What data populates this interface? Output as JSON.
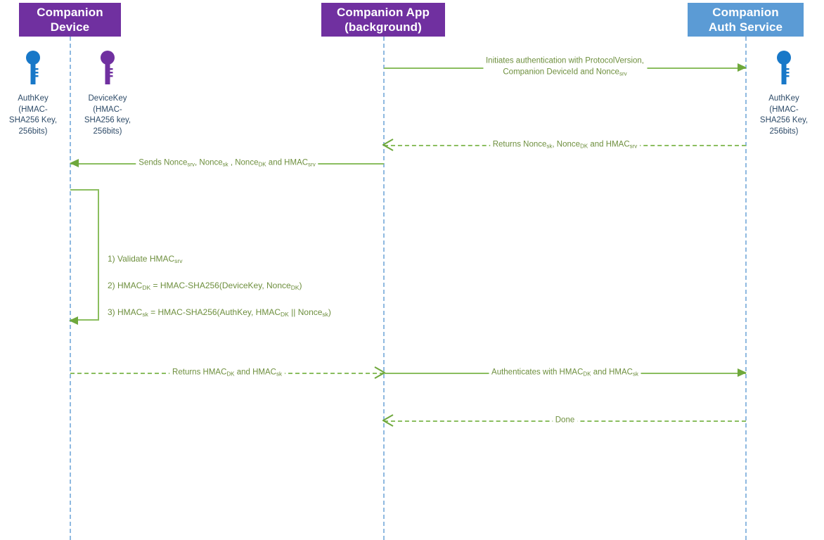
{
  "diagram": {
    "title": "Companion device authentication sequence",
    "colors": {
      "participant_purple": "#7030A0",
      "participant_blue": "#5B9BD5",
      "lifeline": "#8FB9E0",
      "message_line": "#8BBE5F",
      "message_text": "#6E8F3E",
      "caption_text": "#2E4B68",
      "key_blue": "#1878C8",
      "key_purple": "#7030A0",
      "background": "#FFFFFF"
    }
  },
  "participants": [
    {
      "id": "companion-device",
      "line1": "Companion",
      "line2": "Device",
      "style": "purple"
    },
    {
      "id": "companion-app",
      "line1": "Companion App",
      "line2": "(background)",
      "style": "purple"
    },
    {
      "id": "companion-auth-service",
      "line1": "Companion",
      "line2": "Auth Service",
      "style": "blue"
    }
  ],
  "keys": [
    {
      "id": "device-authkey",
      "name": "AuthKey",
      "caption": "AuthKey\n(HMAC-\nSHA256 Key,\n256bits)",
      "color": "#1878C8",
      "owner": "companion-device"
    },
    {
      "id": "device-devicekey",
      "name": "DeviceKey",
      "caption": "DeviceKey\n(HMAC-\nSHA256 key,\n256bits)",
      "color": "#7030A0",
      "owner": "companion-device"
    },
    {
      "id": "service-authkey",
      "name": "AuthKey",
      "caption": "AuthKey\n(HMAC-\nSHA256 Key,\n256bits)",
      "color": "#1878C8",
      "owner": "companion-auth-service"
    }
  ],
  "messages": [
    {
      "id": "msg-initiates",
      "text": "Initiates authentication with ProtocolVersion,\nCompanion DeviceId and Nonce",
      "text_sub": "srv",
      "from": "companion-app",
      "to": "companion-auth-service",
      "style": "solid",
      "arrow": "filled",
      "direction": "right"
    },
    {
      "id": "msg-returns-nonces",
      "text_html": "Returns Nonce<sub>sk</sub>, Nonce<sub>DK</sub> and HMAC<sub>srv</sub>",
      "from": "companion-auth-service",
      "to": "companion-app",
      "style": "dashed",
      "arrow": "open",
      "direction": "left"
    },
    {
      "id": "msg-sends-nonces",
      "text_html": "Sends Nonce<sub>srv</sub>, Nonce<sub>sk</sub> , Nonce<sub>DK</sub> and HMAC<sub>srv</sub>",
      "from": "companion-app",
      "to": "companion-device",
      "style": "solid",
      "arrow": "filled",
      "direction": "left"
    },
    {
      "id": "msg-returns-hmacs",
      "text_html": "Returns HMAC<sub>DK</sub> and HMAC<sub>sk</sub>",
      "from": "companion-device",
      "to": "companion-app",
      "style": "dashed",
      "arrow": "open",
      "direction": "right"
    },
    {
      "id": "msg-authenticates",
      "text_html": "Authenticates with HMAC<sub>DK</sub> and HMAC<sub>sk</sub>",
      "from": "companion-app",
      "to": "companion-auth-service",
      "style": "solid",
      "arrow": "filled",
      "direction": "right"
    },
    {
      "id": "msg-done",
      "text_html": "Done",
      "from": "companion-auth-service",
      "to": "companion-app",
      "style": "dashed",
      "arrow": "open",
      "direction": "left"
    }
  ],
  "self_loop": {
    "id": "device-processing",
    "owner": "companion-device",
    "steps_html": "1) Validate HMAC<sub>srv</sub><br>2) HMAC<sub>DK</sub> = HMAC-SHA256(DeviceKey, Nonce<sub>DK</sub>)<br>3) HMAC<sub>sk</sub> = HMAC-SHA256(AuthKey, HMAC<sub>DK</sub> || Nonce<sub>sk</sub>)",
    "steps": [
      "1) Validate HMACsrv",
      "2) HMACDK = HMAC-SHA256(DeviceKey, NonceDK)",
      "3) HMACsk = HMAC-SHA256(AuthKey, HMACDK || Noncesk)"
    ]
  }
}
